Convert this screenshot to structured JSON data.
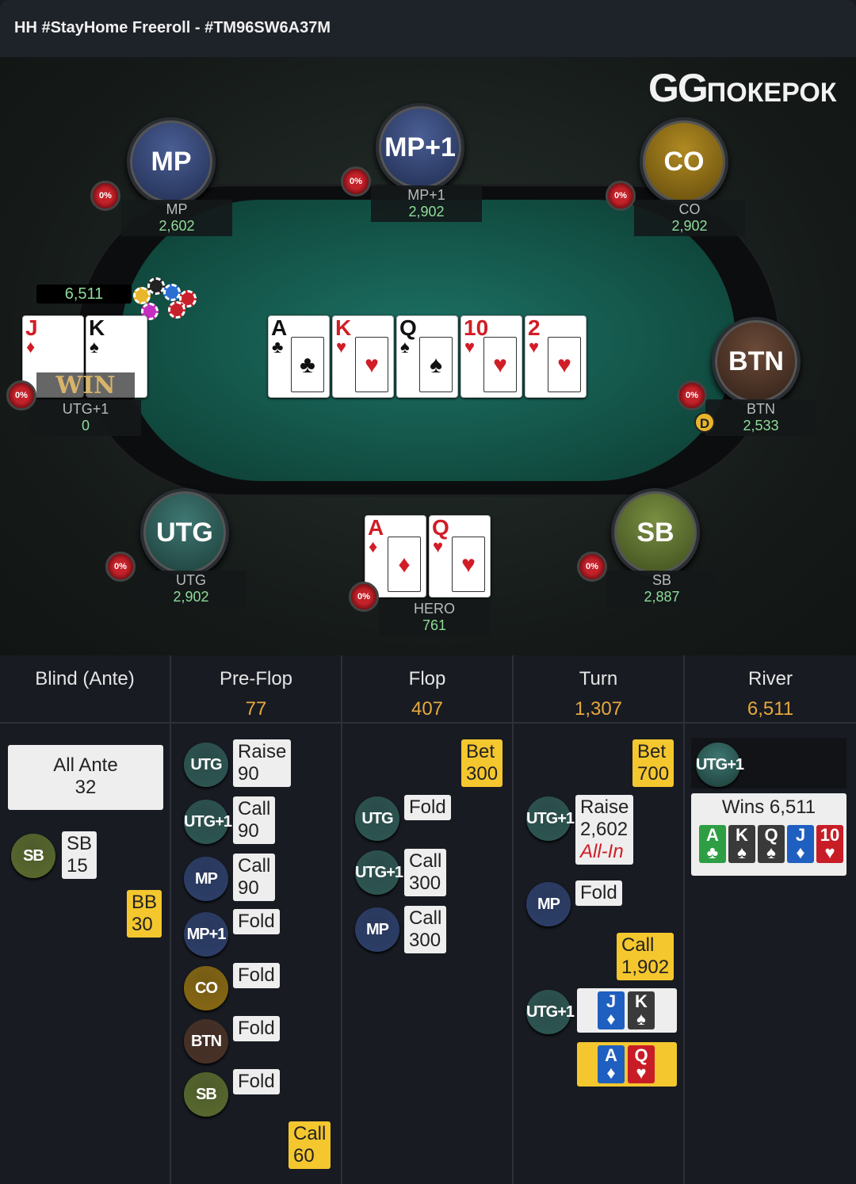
{
  "header": {
    "title": "HH #StayHome Freeroll - #TM96SW6A37M"
  },
  "logo": {
    "mark": "GG",
    "text": "ПОКЕРОК"
  },
  "table": {
    "pot": "6,511",
    "win_text": "WIN",
    "dealer_label": "D",
    "seats": [
      {
        "pos": "MP",
        "name": "MP",
        "stack": "2,602",
        "odds": "0%",
        "color": "#2d3f6a"
      },
      {
        "pos": "MP+1",
        "name": "MP+1",
        "stack": "2,902",
        "odds": "0%",
        "color": "#2d3f6a"
      },
      {
        "pos": "CO",
        "name": "CO",
        "stack": "2,902",
        "odds": "0%",
        "color": "#8a6a12"
      },
      {
        "pos": "BTN",
        "name": "BTN",
        "stack": "2,533",
        "odds": "0%",
        "color": "#4a3226"
      },
      {
        "pos": "SB",
        "name": "SB",
        "stack": "2,887",
        "odds": "0%",
        "color": "#5a6b2e"
      },
      {
        "pos": "UTG",
        "name": "UTG",
        "stack": "2,902",
        "odds": "0%",
        "color": "#2e5753"
      },
      {
        "name": "HERO",
        "stack": "761",
        "odds": "0%"
      },
      {
        "name": "UTG+1",
        "stack": "0",
        "odds": "0%"
      }
    ],
    "board": [
      {
        "rank": "A",
        "suit": "♣",
        "color": "#111111"
      },
      {
        "rank": "K",
        "suit": "♥",
        "color": "#d11d27"
      },
      {
        "rank": "Q",
        "suit": "♠",
        "color": "#111111"
      },
      {
        "rank": "10",
        "suit": "♥",
        "color": "#d11d27"
      },
      {
        "rank": "2",
        "suit": "♥",
        "color": "#d11d27"
      }
    ],
    "hero_cards": [
      {
        "rank": "A",
        "suit": "♦",
        "color": "#d11d27"
      },
      {
        "rank": "Q",
        "suit": "♥",
        "color": "#d11d27"
      }
    ],
    "utg1_cards": [
      {
        "rank": "J",
        "suit": "♦",
        "color": "#d11d27"
      },
      {
        "rank": "K",
        "suit": "♠",
        "color": "#111111"
      }
    ]
  },
  "history": {
    "columns": [
      {
        "name": "Blind (Ante)",
        "pot": ""
      },
      {
        "name": "Pre-Flop",
        "pot": "77"
      },
      {
        "name": "Flop",
        "pot": "407"
      },
      {
        "name": "Turn",
        "pot": "1,307"
      },
      {
        "name": "River",
        "pot": "6,511"
      }
    ],
    "blind": {
      "all_ante": "All Ante",
      "all_ante_amt": "32",
      "sb_badge": "SB",
      "sb_label": "SB",
      "sb_amt": "15",
      "bb_label": "BB",
      "bb_amt": "30"
    },
    "preflop": [
      {
        "badge": "UTG",
        "action": "Raise",
        "amt": "90"
      },
      {
        "badge": "UTG+1",
        "action": "Call",
        "amt": "90"
      },
      {
        "badge": "MP",
        "action": "Call",
        "amt": "90"
      },
      {
        "badge": "MP+1",
        "action": "Fold",
        "amt": ""
      },
      {
        "badge": "CO",
        "action": "Fold",
        "amt": ""
      },
      {
        "badge": "BTN",
        "action": "Fold",
        "amt": ""
      },
      {
        "badge": "SB",
        "action": "Fold",
        "amt": ""
      },
      {
        "hero_action": "Call",
        "hero_amt": "60"
      }
    ],
    "flop": {
      "hero_action": "Bet",
      "hero_amt": "300",
      "rows": [
        {
          "badge": "UTG",
          "action": "Fold",
          "amt": ""
        },
        {
          "badge": "UTG+1",
          "action": "Call",
          "amt": "300"
        },
        {
          "badge": "MP",
          "action": "Call",
          "amt": "300"
        }
      ]
    },
    "turn": {
      "hero_action": "Bet",
      "hero_amt": "700",
      "rows": [
        {
          "badge": "UTG+1",
          "action": "Raise",
          "amt": "2,602",
          "extra": "All-In"
        },
        {
          "badge": "MP",
          "action": "Fold",
          "amt": ""
        }
      ],
      "hero_call": "Call",
      "hero_call_amt": "1,902",
      "showdown_badge": "UTG+1"
    },
    "river": {
      "badge": "UTG+1",
      "wins": "Wins 6,511",
      "cards": [
        {
          "rank": "A",
          "suit": "♣",
          "color": "#2e9e44"
        },
        {
          "rank": "K",
          "suit": "♠",
          "color": "#3a3a3a"
        },
        {
          "rank": "Q",
          "suit": "♠",
          "color": "#3a3a3a"
        },
        {
          "rank": "J",
          "suit": "♦",
          "color": "#1f5fbf"
        },
        {
          "rank": "10",
          "suit": "♥",
          "color": "#c81d27"
        }
      ]
    },
    "badge_colors": {
      "UTG": "#2e5753",
      "UTG+1": "#2e5753",
      "MP": "#2d3f6a",
      "MP+1": "#2d3f6a",
      "CO": "#8a6a12",
      "BTN": "#4a3226",
      "SB": "#5a6b2e"
    }
  }
}
